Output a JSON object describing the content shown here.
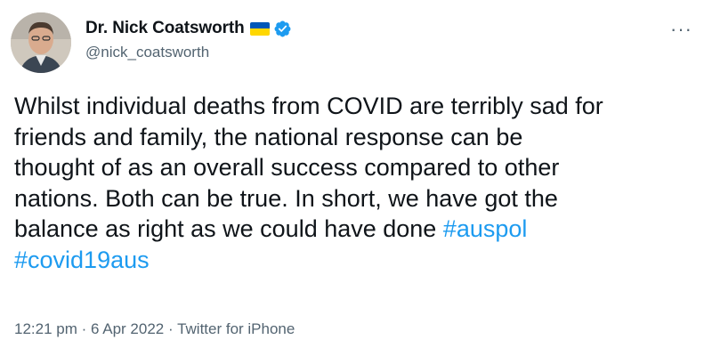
{
  "author": {
    "display_name": "Dr. Nick Coatsworth",
    "handle": "@nick_coatsworth",
    "flag_icon": "ukraine-flag-icon",
    "verified_icon": "verified-badge-icon"
  },
  "menu": {
    "more_label": "···"
  },
  "tweet": {
    "lines": [
      "Whilst individual deaths from COVID are terribly sad for",
      "friends and family, the national response can be",
      "thought of as an overall success compared to other",
      "nations. Both can be true. In short, we have got the"
    ],
    "last_line_text": "balance as right as we could have done ",
    "hashtags": [
      "#auspol",
      "#covid19aus"
    ]
  },
  "meta": {
    "time": "12:21 pm",
    "separator": " · ",
    "date": "6 Apr 2022",
    "source": "Twitter for iPhone"
  },
  "colors": {
    "link": "#1d9bf0",
    "secondary_text": "#536471",
    "primary_text": "#0f1419",
    "flag_blue": "#0057b7",
    "flag_yellow": "#ffd700",
    "verified_blue": "#1d9bf0"
  }
}
